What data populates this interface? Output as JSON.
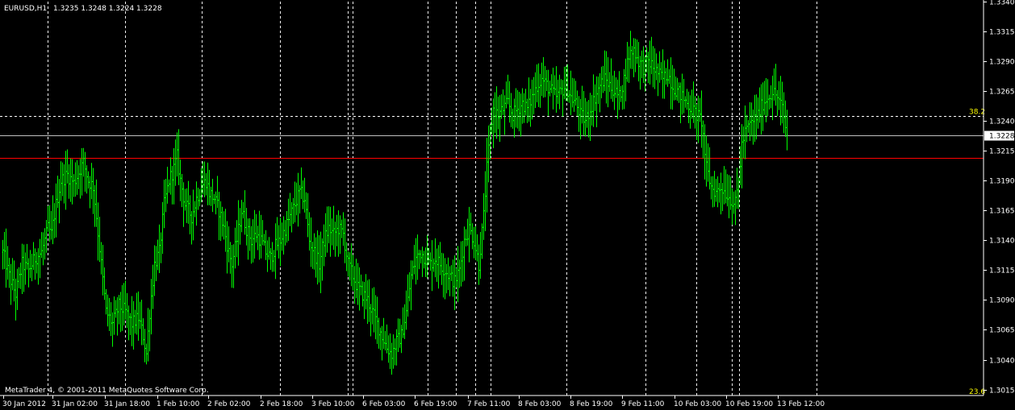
{
  "header": {
    "symbol": "EURUSD,H1",
    "ohlc": "1.3235 1.3248 1.3224 1.3228"
  },
  "footer": {
    "copyright": "MetaTrader 4, © 2001-2011 MetaQuotes Software Corp."
  },
  "colors": {
    "background": "#000000",
    "bars": "#00ff00",
    "grid": "#ffffff",
    "red_line": "#ff0000",
    "fib_label": "#ffff00",
    "current_price_line": "#c0c0c0"
  },
  "chart_data": {
    "type": "ohlc_bar",
    "symbol": "EURUSD",
    "timeframe": "H1",
    "ylim": [
      1.301,
      1.334
    ],
    "y_ticks": [
      "1.3340",
      "1.3315",
      "1.3290",
      "1.3265",
      "1.3240",
      "1.3215",
      "1.3190",
      "1.3165",
      "1.3140",
      "1.3115",
      "1.3090",
      "1.3065",
      "1.3040",
      "1.3015"
    ],
    "x_ticks": [
      "30 Jan 2012",
      "31 Jan 02:00",
      "31 Jan 18:00",
      "1 Feb 10:00",
      "2 Feb 02:00",
      "2 Feb 18:00",
      "3 Feb 10:00",
      "6 Feb 03:00",
      "6 Feb 19:00",
      "7 Feb 11:00",
      "8 Feb 03:00",
      "8 Feb 19:00",
      "9 Feb 11:00",
      "10 Feb 03:00",
      "10 Feb 19:00",
      "13 Feb 12:00"
    ],
    "current_price": "1.3228",
    "horizontal_lines": [
      {
        "name": "fib-38.2",
        "label": "38.2",
        "value": 1.3244
      },
      {
        "name": "current-price",
        "label": "1.3228",
        "value": 1.3228
      },
      {
        "name": "red-level",
        "label": "",
        "value": 1.3209
      }
    ],
    "fib_bottom_label": "23.6",
    "grid": true,
    "close_path": [
      [
        0,
        1.313
      ],
      [
        4,
        1.311
      ],
      [
        8,
        1.3095
      ],
      [
        12,
        1.312
      ],
      [
        16,
        1.3115
      ],
      [
        20,
        1.3125
      ],
      [
        24,
        1.313
      ],
      [
        28,
        1.315
      ],
      [
        30,
        1.3145
      ],
      [
        33,
        1.317
      ],
      [
        36,
        1.319
      ],
      [
        40,
        1.3195
      ],
      [
        44,
        1.3188
      ],
      [
        48,
        1.32
      ],
      [
        50,
        1.3205
      ],
      [
        53,
        1.319
      ],
      [
        56,
        1.3185
      ],
      [
        58,
        1.316
      ],
      [
        61,
        1.312
      ],
      [
        64,
        1.308
      ],
      [
        68,
        1.307
      ],
      [
        72,
        1.3085
      ],
      [
        76,
        1.308
      ],
      [
        80,
        1.307
      ],
      [
        84,
        1.3075
      ],
      [
        87,
        1.306
      ],
      [
        89,
        1.3045
      ],
      [
        91,
        1.308
      ],
      [
        94,
        1.312
      ],
      [
        97,
        1.313
      ],
      [
        100,
        1.317
      ],
      [
        103,
        1.319
      ],
      [
        106,
        1.32
      ],
      [
        108,
        1.321
      ],
      [
        110,
        1.319
      ],
      [
        113,
        1.317
      ],
      [
        117,
        1.316
      ],
      [
        120,
        1.3175
      ],
      [
        123,
        1.3185
      ],
      [
        126,
        1.319
      ],
      [
        128,
        1.318
      ],
      [
        131,
        1.3175
      ],
      [
        134,
        1.3165
      ],
      [
        137,
        1.315
      ],
      [
        140,
        1.313
      ],
      [
        142,
        1.312
      ],
      [
        145,
        1.314
      ],
      [
        148,
        1.3165
      ],
      [
        151,
        1.315
      ],
      [
        154,
        1.314
      ],
      [
        157,
        1.3145
      ],
      [
        160,
        1.314
      ],
      [
        163,
        1.313
      ],
      [
        166,
        1.3125
      ],
      [
        169,
        1.3135
      ],
      [
        172,
        1.314
      ],
      [
        175,
        1.315
      ],
      [
        178,
        1.316
      ],
      [
        181,
        1.317
      ],
      [
        184,
        1.318
      ],
      [
        187,
        1.3175
      ],
      [
        190,
        1.314
      ],
      [
        193,
        1.313
      ],
      [
        196,
        1.312
      ],
      [
        199,
        1.314
      ],
      [
        202,
        1.315
      ],
      [
        205,
        1.3145
      ],
      [
        208,
        1.315
      ],
      [
        211,
        1.3145
      ],
      [
        214,
        1.312
      ],
      [
        217,
        1.311
      ],
      [
        220,
        1.31
      ],
      [
        223,
        1.3095
      ],
      [
        226,
        1.309
      ],
      [
        229,
        1.308
      ],
      [
        232,
        1.307
      ],
      [
        235,
        1.306
      ],
      [
        238,
        1.305
      ],
      [
        241,
        1.3045
      ],
      [
        244,
        1.3055
      ],
      [
        247,
        1.306
      ],
      [
        250,
        1.308
      ],
      [
        253,
        1.311
      ],
      [
        256,
        1.3125
      ],
      [
        259,
        1.313
      ],
      [
        262,
        1.3125
      ],
      [
        265,
        1.312
      ],
      [
        268,
        1.3125
      ],
      [
        271,
        1.312
      ],
      [
        274,
        1.3115
      ],
      [
        277,
        1.311
      ],
      [
        280,
        1.3105
      ],
      [
        283,
        1.3115
      ],
      [
        286,
        1.314
      ],
      [
        289,
        1.315
      ],
      [
        292,
        1.314
      ],
      [
        295,
        1.312
      ],
      [
        298,
        1.316
      ],
      [
        300,
        1.32
      ],
      [
        302,
        1.323
      ],
      [
        304,
        1.325
      ],
      [
        307,
        1.3245
      ],
      [
        310,
        1.325
      ],
      [
        313,
        1.3255
      ],
      [
        316,
        1.3245
      ],
      [
        319,
        1.325
      ],
      [
        322,
        1.3255
      ],
      [
        325,
        1.325
      ],
      [
        328,
        1.326
      ],
      [
        331,
        1.327
      ],
      [
        334,
        1.3275
      ],
      [
        337,
        1.327
      ],
      [
        340,
        1.3265
      ],
      [
        343,
        1.326
      ],
      [
        346,
        1.3265
      ],
      [
        349,
        1.327
      ],
      [
        352,
        1.326
      ],
      [
        355,
        1.3255
      ],
      [
        358,
        1.3245
      ],
      [
        361,
        1.324
      ],
      [
        364,
        1.325
      ],
      [
        367,
        1.326
      ],
      [
        370,
        1.327
      ],
      [
        373,
        1.3275
      ],
      [
        376,
        1.327
      ],
      [
        379,
        1.3265
      ],
      [
        382,
        1.326
      ],
      [
        385,
        1.3275
      ],
      [
        388,
        1.3295
      ],
      [
        391,
        1.33
      ],
      [
        394,
        1.329
      ],
      [
        397,
        1.3285
      ],
      [
        400,
        1.329
      ],
      [
        403,
        1.3285
      ],
      [
        406,
        1.328
      ],
      [
        409,
        1.3275
      ],
      [
        412,
        1.328
      ],
      [
        415,
        1.327
      ],
      [
        418,
        1.3265
      ],
      [
        421,
        1.326
      ],
      [
        424,
        1.3255
      ],
      [
        427,
        1.325
      ],
      [
        430,
        1.3245
      ],
      [
        433,
        1.324
      ],
      [
        436,
        1.32
      ],
      [
        439,
        1.3185
      ],
      [
        442,
        1.318
      ],
      [
        445,
        1.3185
      ],
      [
        448,
        1.318
      ],
      [
        451,
        1.3175
      ],
      [
        454,
        1.317
      ],
      [
        456,
        1.319
      ],
      [
        458,
        1.322
      ],
      [
        460,
        1.323
      ],
      [
        462,
        1.3235
      ],
      [
        465,
        1.324
      ],
      [
        468,
        1.3245
      ],
      [
        471,
        1.3255
      ],
      [
        474,
        1.326
      ],
      [
        477,
        1.3265
      ],
      [
        480,
        1.326
      ],
      [
        483,
        1.325
      ],
      [
        485,
        1.3235
      ],
      [
        486,
        1.3228
      ]
    ]
  }
}
